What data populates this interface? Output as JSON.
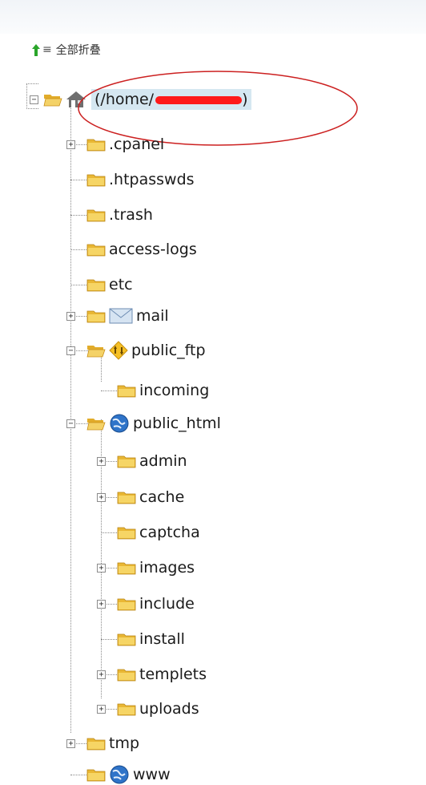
{
  "toolbar": {
    "collapse_all_label": "全部折叠",
    "collapse_all_icon": "collapse-arrow-icon"
  },
  "root": {
    "label": "(/home/",
    "icon": "home-icon",
    "redacted": true
  },
  "nodes": [
    {
      "label": ".cpanel",
      "icon": "folder-icon",
      "expander": "+"
    },
    {
      "label": ".htpasswds",
      "icon": "folder-icon"
    },
    {
      "label": ".trash",
      "icon": "folder-icon"
    },
    {
      "label": "access-logs",
      "icon": "folder-icon"
    },
    {
      "label": "etc",
      "icon": "folder-icon"
    },
    {
      "label": "mail",
      "icon": "envelope-icon",
      "expander": "+"
    },
    {
      "label": "public_ftp",
      "icon": "ftp-icon",
      "expander": "−"
    },
    {
      "label": "incoming",
      "icon": "folder-icon"
    },
    {
      "label": "public_html",
      "icon": "globe-icon",
      "expander": "−"
    },
    {
      "label": "admin",
      "icon": "folder-icon",
      "expander": "+"
    },
    {
      "label": "cache",
      "icon": "folder-icon",
      "expander": "+"
    },
    {
      "label": "captcha",
      "icon": "folder-icon"
    },
    {
      "label": "images",
      "icon": "folder-icon",
      "expander": "+"
    },
    {
      "label": "include",
      "icon": "folder-icon",
      "expander": "+"
    },
    {
      "label": "install",
      "icon": "folder-icon"
    },
    {
      "label": "templets",
      "icon": "folder-icon",
      "expander": "+"
    },
    {
      "label": "uploads",
      "icon": "folder-icon",
      "expander": "+"
    },
    {
      "label": "tmp",
      "icon": "folder-icon",
      "expander": "+"
    },
    {
      "label": "www",
      "icon": "globe-icon"
    }
  ],
  "colors": {
    "folder": "#f2c945",
    "selection": "#d5e7f1",
    "annotation": "#cc0000",
    "redaction": "#ff0000"
  }
}
